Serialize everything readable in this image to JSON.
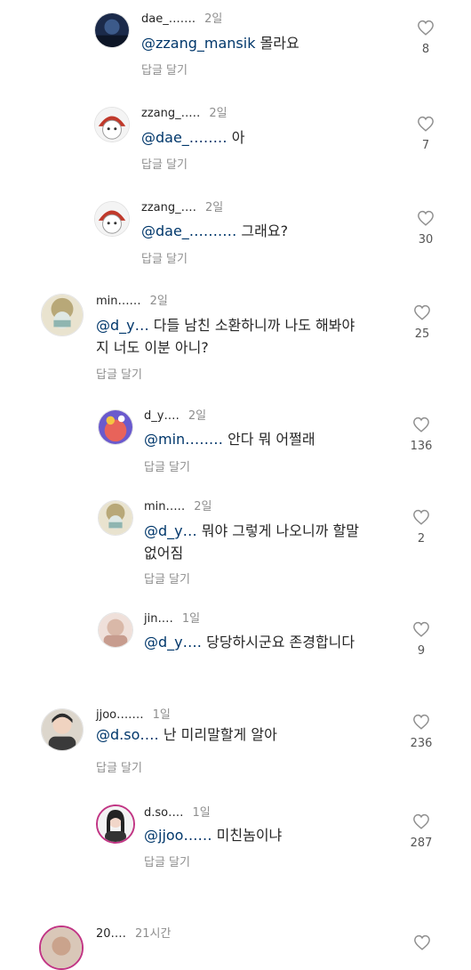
{
  "comments": [
    {
      "username": "dae_․․․․․․․",
      "time": "2일",
      "mention": "@zzang_mansik",
      "body": " 몰라요",
      "reply": "답글 달기",
      "likes": "8",
      "avatar": "dark-avatar"
    },
    {
      "username": "zzang_․․․․․",
      "time": "2일",
      "mention": "@dae_․․․․․․․․",
      "body": " 아",
      "reply": "답글 달기",
      "likes": "7",
      "avatar": "cartoon-avatar"
    },
    {
      "username": "zzang_․․․․",
      "time": "2일",
      "mention": "@dae_․․․․․․․․․․",
      "body": " 그래요?",
      "reply": "답글 달기",
      "likes": "30",
      "avatar": "cartoon-avatar"
    },
    {
      "username": "min․․․․․․",
      "time": "2일",
      "mention": "@d_y․․․",
      "body": " 다들 남친 소환하니까 나도 해봐야",
      "body2": "지 너도 이분 아니?",
      "reply": "답글 달기",
      "likes": "25",
      "avatar": "beige-avatar"
    },
    {
      "username": "d_y․․․․",
      "time": "2일",
      "mention": "@min․․․․․․․․",
      "body": " 안다 뭐 어쩔래",
      "reply": "답글 달기",
      "likes": "136",
      "avatar": "photo-avatar"
    },
    {
      "username": "min․․․․․",
      "time": "2일",
      "mention": "@d_y․․․",
      "body": " 뭐야 그렇게 나오니까 할말",
      "body2": "없어짐",
      "reply": "답글 달기",
      "likes": "2",
      "avatar": "beige-avatar"
    },
    {
      "username": "jin․․․․",
      "time": "1일",
      "mention": "@d_y․․․․",
      "body": " 당당하시군요 존경합니다",
      "reply": "",
      "likes": "9",
      "avatar": "pink-avatar"
    },
    {
      "username": "jjoo․․․․․․․",
      "time": "1일",
      "mention": "@d.so․․․․",
      "body": " 난 미리말할게 알아",
      "reply": "답글 달기",
      "likes": "236",
      "avatar": "person-avatar"
    },
    {
      "username": "d.so․․․․",
      "time": "1일",
      "mention": "@jjoo․․․․․․",
      "body": " 미친놈이냐",
      "reply": "답글 달기",
      "likes": "287",
      "avatar": "story-avatar"
    },
    {
      "username": "20․․․․",
      "time": "21시간",
      "mention": "",
      "body": "",
      "reply": "",
      "likes": "",
      "avatar": "story-avatar"
    }
  ],
  "colors": {
    "mention": "#00376b",
    "secondary": "#8e8e8e",
    "text": "#262626"
  }
}
